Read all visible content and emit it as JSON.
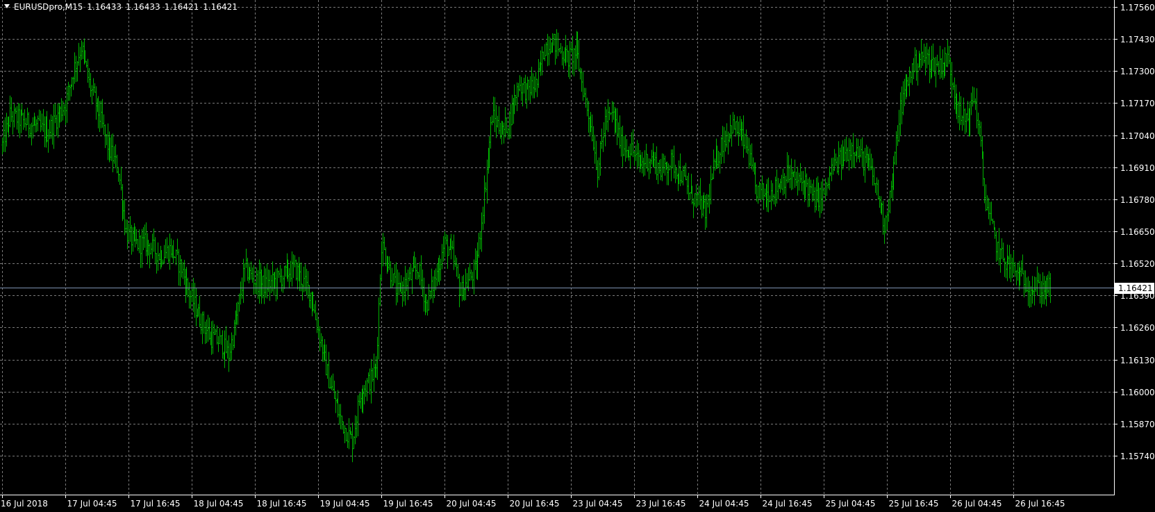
{
  "header": {
    "symbol": "EURUSDpro,M15",
    "open": "1.16433",
    "high": "1.16433",
    "low": "1.16421",
    "close": "1.16421"
  },
  "colors": {
    "background": "#000000",
    "bars": "#00b400",
    "grid": "#7a7a7a",
    "price_line": "#7f93b3",
    "axis_text": "#ffffff"
  },
  "current_price": "1.16421",
  "chart_data": {
    "type": "ohlc",
    "title": "EURUSDpro,M15",
    "ylim": [
      1.1574,
      1.1756
    ],
    "grid": true,
    "y_ticks": [
      "1.17560",
      "1.17430",
      "1.17300",
      "1.17170",
      "1.17040",
      "1.16910",
      "1.16780",
      "1.16650",
      "1.16520",
      "1.16390",
      "1.16260",
      "1.16130",
      "1.16000",
      "1.15870",
      "1.15740"
    ],
    "x_ticks": [
      "16 Jul 2018",
      "17 Jul 04:45",
      "17 Jul 16:45",
      "18 Jul 04:45",
      "18 Jul 16:45",
      "19 Jul 04:45",
      "19 Jul 16:45",
      "20 Jul 04:45",
      "20 Jul 16:45",
      "23 Jul 04:45",
      "23 Jul 16:45",
      "24 Jul 04:45",
      "24 Jul 16:45",
      "25 Jul 04:45",
      "25 Jul 16:45",
      "26 Jul 04:45",
      "26 Jul 16:45"
    ],
    "bars_per_label": 48,
    "price_path": [
      [
        0,
        1.17
      ],
      [
        6,
        1.1712
      ],
      [
        14,
        1.171
      ],
      [
        24,
        1.1708
      ],
      [
        34,
        1.1705
      ],
      [
        40,
        1.171
      ],
      [
        48,
        1.1717
      ],
      [
        54,
        1.173
      ],
      [
        60,
        1.174
      ],
      [
        66,
        1.1725
      ],
      [
        72,
        1.1715
      ],
      [
        80,
        1.17
      ],
      [
        88,
        1.169
      ],
      [
        94,
        1.1665
      ],
      [
        100,
        1.166
      ],
      [
        110,
        1.166
      ],
      [
        120,
        1.1655
      ],
      [
        128,
        1.1658
      ],
      [
        136,
        1.165
      ],
      [
        142,
        1.164
      ],
      [
        150,
        1.163
      ],
      [
        158,
        1.1622
      ],
      [
        166,
        1.162
      ],
      [
        172,
        1.1615
      ],
      [
        178,
        1.163
      ],
      [
        184,
        1.165
      ],
      [
        192,
        1.1645
      ],
      [
        200,
        1.1643
      ],
      [
        208,
        1.1645
      ],
      [
        216,
        1.1648
      ],
      [
        222,
        1.165
      ],
      [
        228,
        1.1645
      ],
      [
        234,
        1.164
      ],
      [
        242,
        1.162
      ],
      [
        248,
        1.1605
      ],
      [
        256,
        1.159
      ],
      [
        262,
        1.1583
      ],
      [
        266,
        1.158
      ],
      [
        272,
        1.16
      ],
      [
        280,
        1.1605
      ],
      [
        284,
        1.161
      ],
      [
        288,
        1.166
      ],
      [
        294,
        1.165
      ],
      [
        300,
        1.164
      ],
      [
        308,
        1.1645
      ],
      [
        316,
        1.165
      ],
      [
        322,
        1.1635
      ],
      [
        330,
        1.1648
      ],
      [
        336,
        1.166
      ],
      [
        342,
        1.1655
      ],
      [
        348,
        1.164
      ],
      [
        354,
        1.1645
      ],
      [
        360,
        1.165
      ],
      [
        366,
        1.168
      ],
      [
        372,
        1.1712
      ],
      [
        380,
        1.1705
      ],
      [
        386,
        1.1712
      ],
      [
        392,
        1.1725
      ],
      [
        398,
        1.1722
      ],
      [
        406,
        1.1725
      ],
      [
        412,
        1.174
      ],
      [
        418,
        1.1742
      ],
      [
        424,
        1.1738
      ],
      [
        430,
        1.1735
      ],
      [
        436,
        1.1738
      ],
      [
        442,
        1.172
      ],
      [
        448,
        1.1705
      ],
      [
        452,
        1.169
      ],
      [
        458,
        1.171
      ],
      [
        464,
        1.1712
      ],
      [
        470,
        1.17
      ],
      [
        478,
        1.1698
      ],
      [
        484,
        1.1692
      ],
      [
        492,
        1.1695
      ],
      [
        500,
        1.169
      ],
      [
        508,
        1.1693
      ],
      [
        516,
        1.1688
      ],
      [
        522,
        1.168
      ],
      [
        528,
        1.1678
      ],
      [
        534,
        1.1672
      ],
      [
        540,
        1.169
      ],
      [
        546,
        1.17
      ],
      [
        554,
        1.1708
      ],
      [
        560,
        1.1705
      ],
      [
        566,
        1.1698
      ],
      [
        572,
        1.1682
      ],
      [
        580,
        1.168
      ],
      [
        588,
        1.1683
      ],
      [
        596,
        1.1688
      ],
      [
        604,
        1.1685
      ],
      [
        610,
        1.1685
      ],
      [
        616,
        1.1678
      ],
      [
        624,
        1.168
      ],
      [
        630,
        1.169
      ],
      [
        638,
        1.1695
      ],
      [
        646,
        1.17
      ],
      [
        652,
        1.1695
      ],
      [
        658,
        1.1692
      ],
      [
        664,
        1.1682
      ],
      [
        670,
        1.1668
      ],
      [
        676,
        1.1685
      ],
      [
        682,
        1.1715
      ],
      [
        690,
        1.173
      ],
      [
        696,
        1.1735
      ],
      [
        702,
        1.1735
      ],
      [
        710,
        1.1732
      ],
      [
        718,
        1.1735
      ],
      [
        722,
        1.1725
      ],
      [
        728,
        1.171
      ],
      [
        734,
        1.1712
      ],
      [
        738,
        1.172
      ],
      [
        742,
        1.1705
      ],
      [
        746,
        1.168
      ],
      [
        752,
        1.1665
      ],
      [
        758,
        1.1655
      ],
      [
        764,
        1.1652
      ],
      [
        770,
        1.1648
      ],
      [
        776,
        1.1645
      ],
      [
        782,
        1.1642
      ],
      [
        790,
        1.1642
      ],
      [
        796,
        1.1642
      ]
    ]
  }
}
